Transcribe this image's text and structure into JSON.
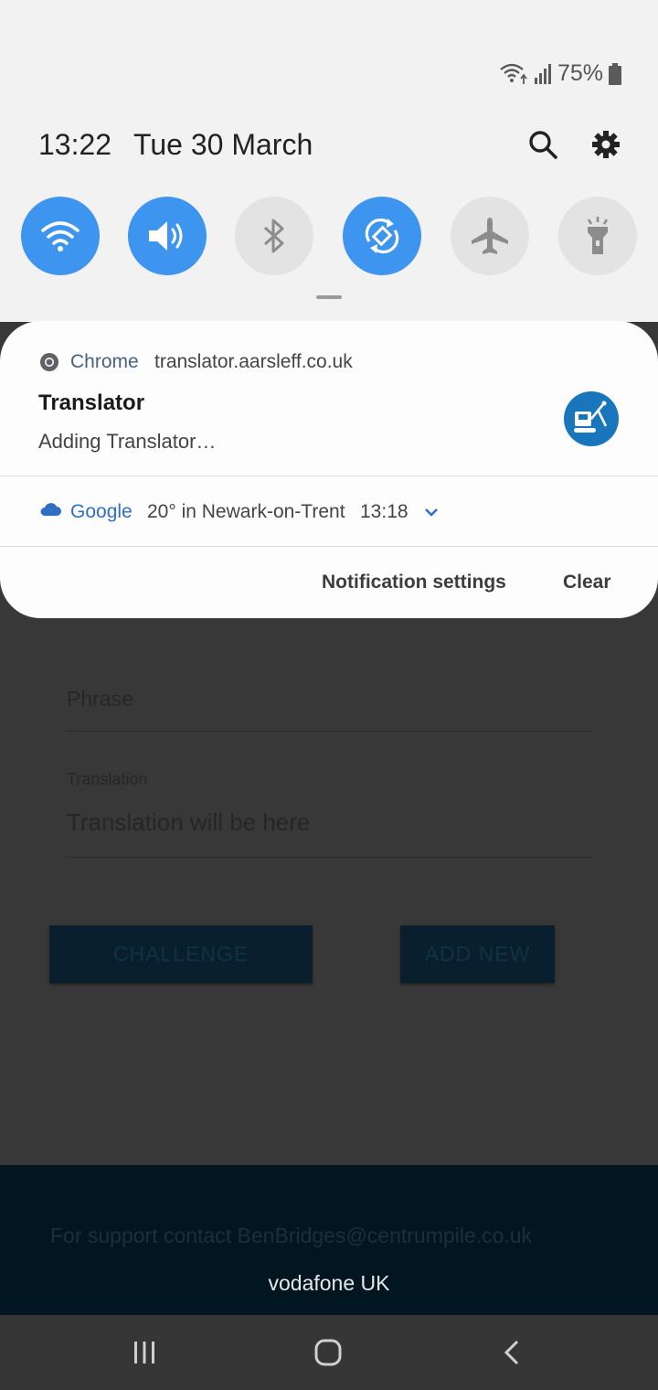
{
  "status_bar": {
    "battery_percent": "75%",
    "icons": [
      "wifi-calling-icon",
      "signal-icon",
      "battery-icon"
    ]
  },
  "quick_panel": {
    "time": "13:22",
    "date": "Tue 30 March",
    "tiles": [
      {
        "name": "wifi",
        "state": "on",
        "icon": "wifi-icon"
      },
      {
        "name": "sound",
        "state": "on",
        "icon": "volume-icon"
      },
      {
        "name": "bluetooth",
        "state": "off",
        "icon": "bluetooth-icon"
      },
      {
        "name": "auto-rotate",
        "state": "on",
        "icon": "rotate-icon"
      },
      {
        "name": "airplane-mode",
        "state": "off",
        "icon": "airplane-icon"
      },
      {
        "name": "flashlight",
        "state": "off",
        "icon": "flashlight-icon"
      }
    ],
    "accent_color": "#3e95ef"
  },
  "notifications": [
    {
      "app": "Chrome",
      "source": "translator.aarsleff.co.uk",
      "title": "Translator",
      "body": "Adding Translator…",
      "app_icon": "chrome-icon",
      "large_icon": "translator-app-icon"
    },
    {
      "app": "Google",
      "text": "20° in Newark-on-Trent",
      "time": "13:18",
      "app_icon": "cloud-icon"
    }
  ],
  "notification_actions": {
    "settings": "Notification settings",
    "clear": "Clear"
  },
  "background_app": {
    "phrase_placeholder": "Phrase",
    "translation_label": "Translation",
    "translation_value": "Translation will be here",
    "challenge_button": "CHALLENGE",
    "add_new_button": "ADD NEW",
    "support_text": "For support contact BenBridges@centrumpile.co.uk",
    "carrier": "vodafone UK"
  },
  "nav_bar": {
    "buttons": [
      "recents-icon",
      "home-icon",
      "back-icon"
    ]
  }
}
